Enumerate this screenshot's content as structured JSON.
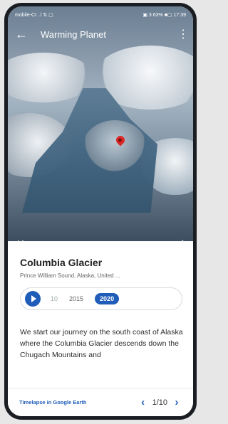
{
  "status": {
    "left": "mobile-CI ..l ⇅ ▢",
    "right": "▣ 3.63% ■▢ 17:39"
  },
  "appbar": {
    "title": "Warming Planet",
    "back_icon": "arrow-left-icon",
    "menu_icon": "more-vert-icon"
  },
  "place": {
    "name": "Columbia Glacier",
    "location": "Prince William Sound, Alaska, United ..."
  },
  "timeline": {
    "years": [
      "10",
      "2015",
      "2020"
    ],
    "selected": "2020"
  },
  "description": "We start our journey on the south coast of Alaska where the Columbia Glacier descends down the Chugach Mountains and",
  "footer": {
    "link": "Timelapse in Google Earth",
    "page": "1/10"
  },
  "colors": {
    "accent": "#1f5db8",
    "pin": "#d92828"
  }
}
